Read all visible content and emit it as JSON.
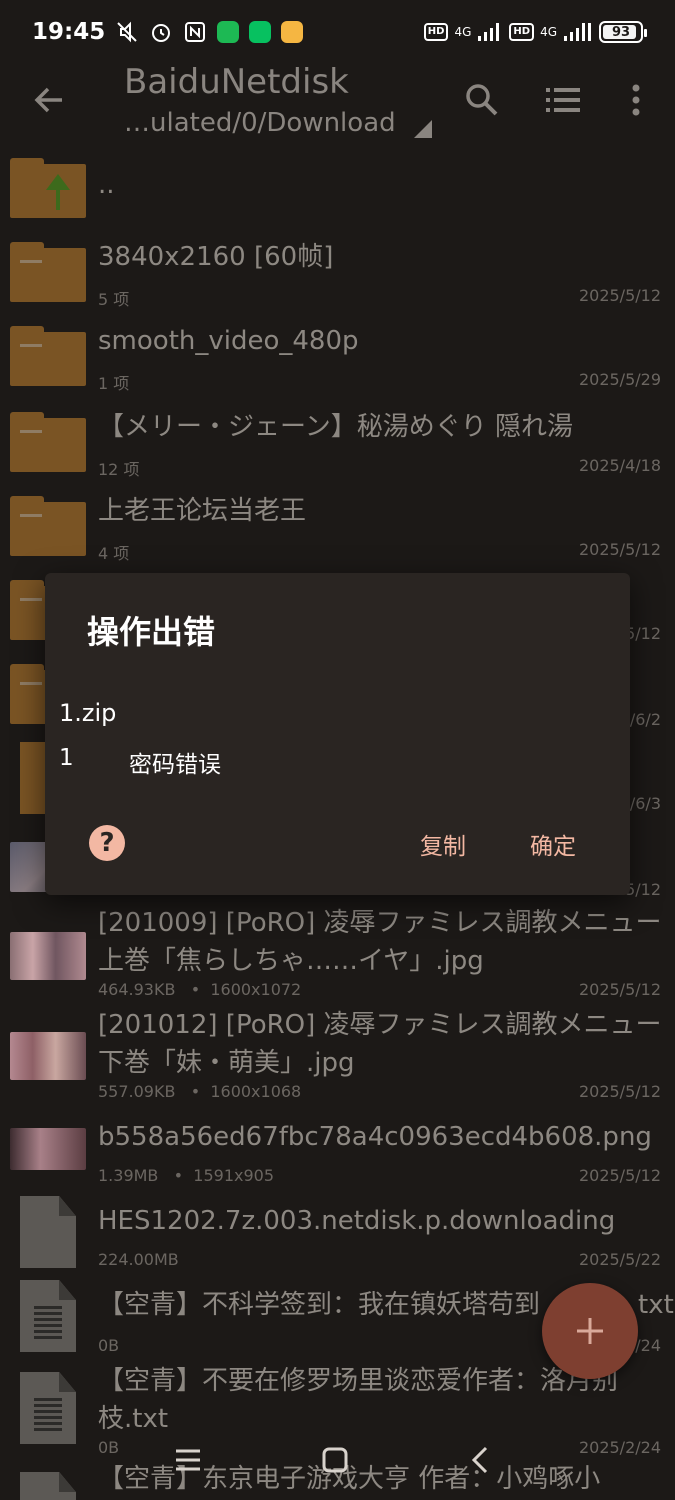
{
  "status_bar": {
    "time": "19:45",
    "network_left": "4G",
    "network_right": "4G",
    "hd": "HD",
    "battery": "93",
    "battery_percent": 93
  },
  "toolbar": {
    "title": "BaiduNetdisk",
    "path": "…ulated/0/Download"
  },
  "files": [
    {
      "name": "..",
      "meta": "",
      "date": "",
      "icon": "folder-up"
    },
    {
      "name": "3840x2160 [60帧]",
      "meta": "5 项",
      "date": "2025/5/12",
      "icon": "folder"
    },
    {
      "name": "smooth_video_480p",
      "meta": "1 项",
      "date": "2025/5/29",
      "icon": "folder"
    },
    {
      "name": "【メリー・ジェーン】秘湯めぐり 隠れ湯",
      "meta": "12 项",
      "date": "2025/4/18",
      "icon": "folder"
    },
    {
      "name": "上老王论坛当老王",
      "meta": "4 项",
      "date": "2025/5/12",
      "icon": "folder"
    },
    {
      "name": "",
      "meta": "",
      "date": "5/12",
      "icon": "folder"
    },
    {
      "name": "",
      "meta": "",
      "date": "/6/2",
      "icon": "folder"
    },
    {
      "name": "",
      "meta": "",
      "date": "/6/3",
      "icon": "zip"
    },
    {
      "name": "",
      "meta": "",
      "date": "5/12",
      "icon": "image"
    },
    {
      "name": "[201009] [PoRO] 凌辱ファミレス調教メニュー 上巻「焦らしちゃ……イヤ」.jpg",
      "meta": "464.93KB",
      "dims": "1600x1072",
      "date": "2025/5/12",
      "icon": "image"
    },
    {
      "name": "[201012] [PoRO] 凌辱ファミレス調教メニュー 下巻「妹・萌美」.jpg",
      "meta": "557.09KB",
      "dims": "1600x1068",
      "date": "2025/5/12",
      "icon": "image"
    },
    {
      "name": "b558a56ed67fbc78a4c0963ecd4b608.png",
      "meta": "1.39MB",
      "dims": "1591x905",
      "date": "2025/5/12",
      "icon": "image"
    },
    {
      "name": "HES1202.7z.003.netdisk.p.downloading",
      "meta": "224.00MB",
      "date": "2025/5/22",
      "icon": "file"
    },
    {
      "name": "【空青】不科学签到：我在镇妖塔苟到",
      "name_tail": "txt",
      "meta": "0B",
      "date": "/24",
      "icon": "text"
    },
    {
      "name": "【空青】不要在修罗场里谈恋爱作者：洛月别枝.txt",
      "meta": "0B",
      "date": "2025/2/24",
      "icon": "text"
    },
    {
      "name": "【空青】东京电子游戏大亨 作者：小鸡啄小",
      "meta": "",
      "date": "",
      "icon": "text"
    }
  ],
  "dialog": {
    "title": "操作出错",
    "file": "1.zip",
    "error_code": "1",
    "error_message": "密码错误",
    "copy_label": "复制",
    "ok_label": "确定",
    "help_label": "?"
  },
  "colors": {
    "background": "#1c1917",
    "folder": "#7a5424",
    "dialog_bg": "#2a2522",
    "accent": "#f3b8a3",
    "fab": "#7e3f30"
  }
}
